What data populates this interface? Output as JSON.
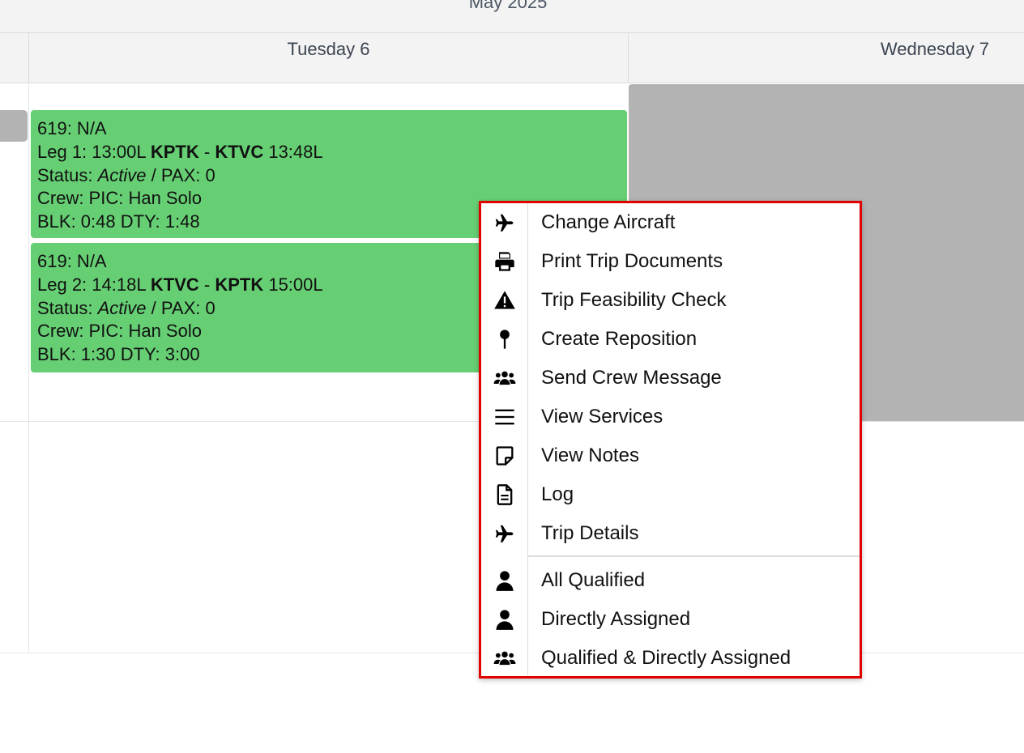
{
  "calendar": {
    "month_title": "May 2025",
    "days": [
      {
        "label": "Tuesday 6"
      },
      {
        "label": "Wednesday 7"
      }
    ]
  },
  "events": [
    {
      "trip": "619: N/A",
      "leg": "Leg 1: ",
      "dep_time": "13:00L ",
      "origin": "KPTK",
      "sep": " - ",
      "dest": "KTVC",
      "arr_time": " 13:48L",
      "status_prefix": "Status: ",
      "status": "Active",
      "pax": " / PAX: 0",
      "crew": "Crew: PIC: Han Solo",
      "times": "BLK: 0:48 DTY: 1:48",
      "color": "#66cf74"
    },
    {
      "trip": "619: N/A",
      "leg": "Leg 2: ",
      "dep_time": "14:18L ",
      "origin": "KTVC",
      "sep": " - ",
      "dest": "KPTK",
      "arr_time": " 15:00L",
      "status_prefix": "Status: ",
      "status": "Active",
      "pax": " / PAX: 0",
      "crew": "Crew: PIC: Han Solo",
      "times": "BLK: 1:30 DTY: 3:00",
      "color": "#66cf74"
    }
  ],
  "context_menu": {
    "border_color": "#e00000",
    "items": [
      {
        "label": "Change Aircraft",
        "icon": "plane-icon"
      },
      {
        "label": "Print Trip Documents",
        "icon": "printer-icon"
      },
      {
        "label": "Trip Feasibility Check",
        "icon": "warning-icon"
      },
      {
        "label": "Create Reposition",
        "icon": "map-pin-icon"
      },
      {
        "label": "Send Crew Message",
        "icon": "users-icon"
      },
      {
        "label": "View Services",
        "icon": "list-icon"
      },
      {
        "label": "View Notes",
        "icon": "sticky-note-icon"
      },
      {
        "label": "Log",
        "icon": "file-text-icon"
      },
      {
        "label": "Trip Details",
        "icon": "plane-icon"
      },
      {
        "label": "All Qualified",
        "icon": "user-icon"
      },
      {
        "label": "Directly Assigned",
        "icon": "user-icon"
      },
      {
        "label": "Qualified & Directly Assigned",
        "icon": "users-icon"
      }
    ]
  }
}
